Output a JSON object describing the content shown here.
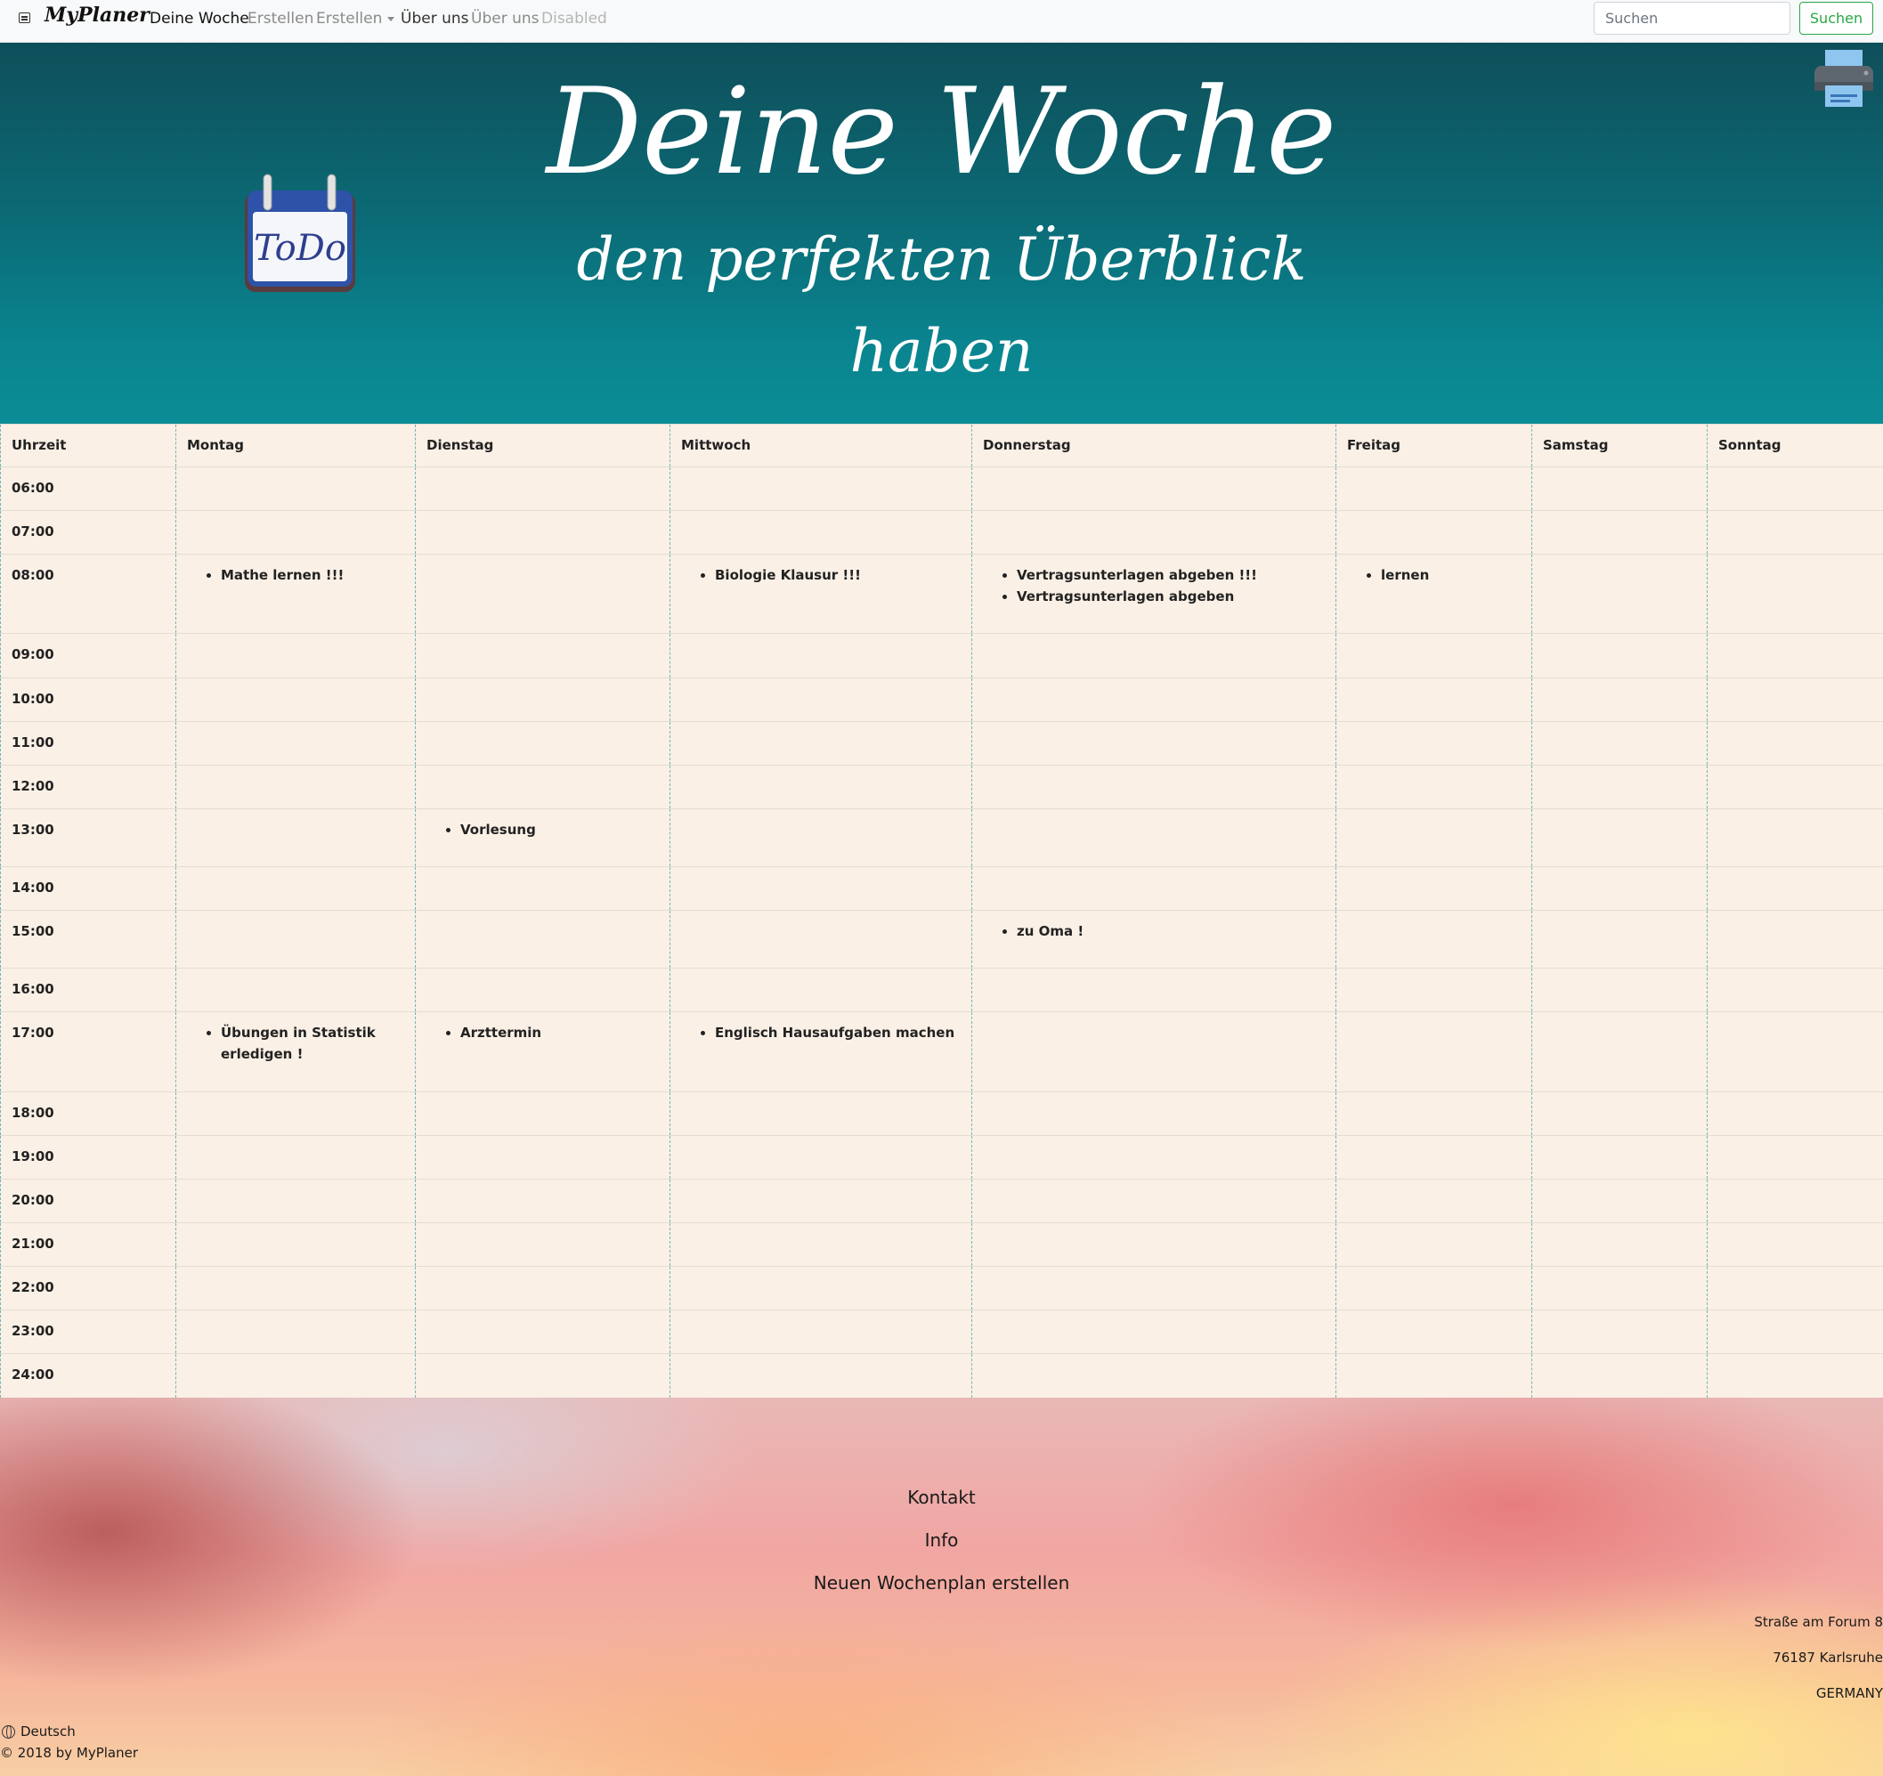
{
  "navbar": {
    "brand": "MyPlaner",
    "links": [
      "Deine Woche",
      "Erstellen",
      "Erstellen",
      "Über uns",
      "Über uns",
      "Disabled"
    ],
    "search_placeholder": "Suchen",
    "search_button": "Suchen"
  },
  "hero": {
    "title": "Deine Woche",
    "subtitle_line1": "den perfekten Überblick",
    "subtitle_line2": "haben",
    "todo_label": "ToDo"
  },
  "schedule": {
    "headers": [
      "Uhrzeit",
      "Montag",
      "Dienstag",
      "Mittwoch",
      "Donnerstag",
      "Freitag",
      "Samstag",
      "Sonntag"
    ],
    "rows": [
      {
        "time": "06:00",
        "cells": [
          [],
          [],
          [],
          [],
          [],
          [],
          []
        ]
      },
      {
        "time": "07:00",
        "cells": [
          [],
          [],
          [],
          [],
          [],
          [],
          []
        ]
      },
      {
        "time": "08:00",
        "cells": [
          [
            "Mathe lernen !!!"
          ],
          [],
          [
            "Biologie Klausur !!!"
          ],
          [
            "Vertragsunterlagen abgeben !!!",
            "Vertragsunterlagen abgeben"
          ],
          [
            "lernen"
          ],
          [],
          []
        ]
      },
      {
        "time": "09:00",
        "cells": [
          [],
          [],
          [],
          [],
          [],
          [],
          []
        ]
      },
      {
        "time": "10:00",
        "cells": [
          [],
          [],
          [],
          [],
          [],
          [],
          []
        ]
      },
      {
        "time": "11:00",
        "cells": [
          [],
          [],
          [],
          [],
          [],
          [],
          []
        ]
      },
      {
        "time": "12:00",
        "cells": [
          [],
          [],
          [],
          [],
          [],
          [],
          []
        ]
      },
      {
        "time": "13:00",
        "cells": [
          [],
          [
            "Vorlesung"
          ],
          [],
          [],
          [],
          [],
          []
        ]
      },
      {
        "time": "14:00",
        "cells": [
          [],
          [],
          [],
          [],
          [],
          [],
          []
        ]
      },
      {
        "time": "15:00",
        "cells": [
          [],
          [],
          [],
          [
            "zu Oma !"
          ],
          [],
          [],
          []
        ]
      },
      {
        "time": "16:00",
        "cells": [
          [],
          [],
          [],
          [],
          [],
          [],
          []
        ]
      },
      {
        "time": "17:00",
        "cells": [
          [
            "Übungen in Statistik erledigen !"
          ],
          [
            "Arzttermin"
          ],
          [
            "Englisch Hausaufgaben machen"
          ],
          [],
          [],
          [],
          []
        ]
      },
      {
        "time": "18:00",
        "cells": [
          [],
          [],
          [],
          [],
          [],
          [],
          []
        ]
      },
      {
        "time": "19:00",
        "cells": [
          [],
          [],
          [],
          [],
          [],
          [],
          []
        ]
      },
      {
        "time": "20:00",
        "cells": [
          [],
          [],
          [],
          [],
          [],
          [],
          []
        ]
      },
      {
        "time": "21:00",
        "cells": [
          [],
          [],
          [],
          [],
          [],
          [],
          []
        ]
      },
      {
        "time": "22:00",
        "cells": [
          [],
          [],
          [],
          [],
          [],
          [],
          []
        ]
      },
      {
        "time": "23:00",
        "cells": [
          [],
          [],
          [],
          [],
          [],
          [],
          []
        ]
      },
      {
        "time": "24:00",
        "cells": [
          [],
          [],
          [],
          [],
          [],
          [],
          []
        ]
      }
    ]
  },
  "footer": {
    "links": [
      "Kontakt",
      "Info",
      "Neuen Wochenplan erstellen"
    ],
    "address": [
      "Straße am Forum 8",
      "76187 Karlsruhe",
      "GERMANY"
    ],
    "language": "Deutsch",
    "copyright": "© 2018 by MyPlaner"
  },
  "colors": {
    "hero_bg": "#0b6a75",
    "table_bg": "#faf0e6",
    "search_button": "#28a745"
  }
}
